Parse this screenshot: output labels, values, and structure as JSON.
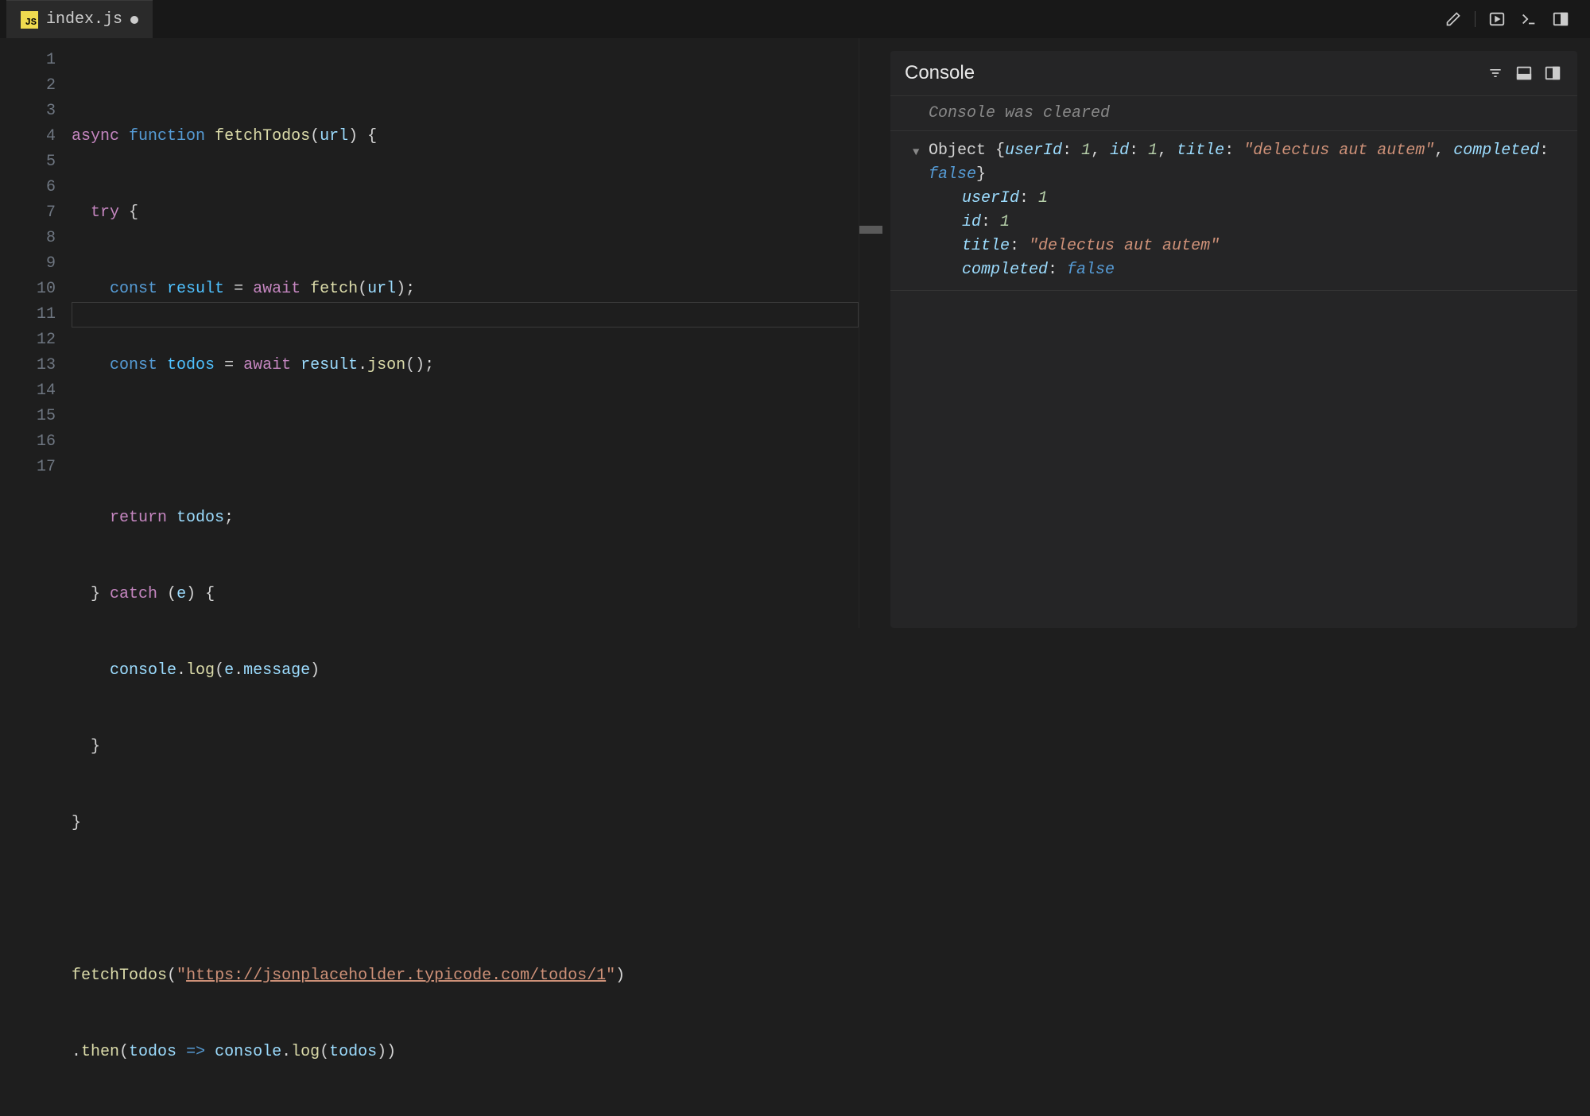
{
  "tab": {
    "filename": "index.js",
    "dirty": true
  },
  "editor": {
    "lineNumbers": [
      "1",
      "2",
      "3",
      "4",
      "5",
      "6",
      "7",
      "8",
      "9",
      "10",
      "11",
      "12",
      "13",
      "14",
      "15",
      "16",
      "17"
    ],
    "cursorLine": 11,
    "code": {
      "l1": {
        "async": "async",
        "function": "function",
        "name": "fetchTodos",
        "paren_open": "(",
        "param": "url",
        "paren_close": ")",
        "brace": " {"
      },
      "l2": {
        "try": "try",
        "brace": " {"
      },
      "l3": {
        "const": "const",
        "var": "result",
        "eq": " = ",
        "await": "await",
        "fn": " fetch",
        "po": "(",
        "arg": "url",
        "pc": ");"
      },
      "l4": {
        "const": "const",
        "var": "todos",
        "eq": " = ",
        "await": "await",
        "obj": " result",
        "dot": ".",
        "method": "json",
        "call": "();"
      },
      "l6": {
        "return": "return",
        "var": " todos",
        "semi": ";"
      },
      "l7": {
        "brace": "} ",
        "catch": "catch",
        "po": " (",
        "param": "e",
        "pc": ") {"
      },
      "l8": {
        "obj": "console",
        "dot": ".",
        "method": "log",
        "po": "(",
        "arg": "e",
        "dot2": ".",
        "prop": "message",
        "pc": ")"
      },
      "l9": {
        "brace": "}"
      },
      "l10": {
        "brace": "}"
      },
      "l12": {
        "fn": "fetchTodos",
        "po": "(",
        "q1": "\"",
        "url": "https://jsonplaceholder.typicode.com/todos/1",
        "q2": "\"",
        "pc": ")"
      },
      "l13": {
        "dot": ".",
        "method": "then",
        "po": "(",
        "param": "todos",
        "arrow": " => ",
        "obj": "console",
        "dot2": ".",
        "method2": "log",
        "po2": "(",
        "arg": "todos",
        "pc": "))"
      }
    }
  },
  "console": {
    "title": "Console",
    "cleared": "Console was cleared",
    "object": {
      "label": "Object",
      "summary": {
        "userId_k": "userId",
        "userId_v": "1",
        "id_k": "id",
        "id_v": "1",
        "title_k": "title",
        "title_v": "\"delectus aut autem\"",
        "completed_k": "completed",
        "completed_v": "false"
      },
      "props": [
        {
          "key": "userId",
          "value": "1",
          "type": "num"
        },
        {
          "key": "id",
          "value": "1",
          "type": "num"
        },
        {
          "key": "title",
          "value": "\"delectus aut autem\"",
          "type": "str"
        },
        {
          "key": "completed",
          "value": "false",
          "type": "bool"
        }
      ]
    }
  }
}
